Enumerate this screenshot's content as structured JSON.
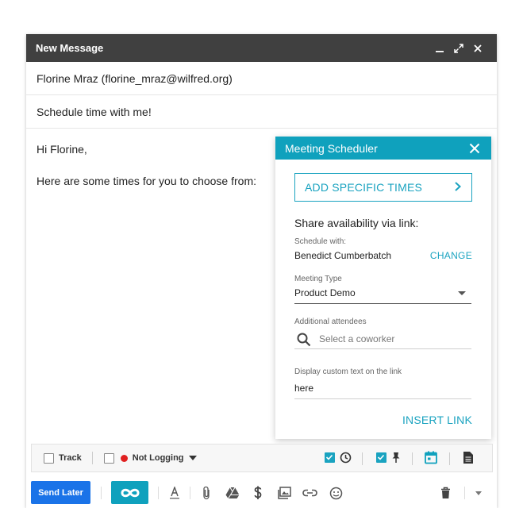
{
  "window": {
    "title": "New Message",
    "to": "Florine Mraz (florine_mraz@wilfred.org)",
    "subject": "Schedule time with me!"
  },
  "body": {
    "greeting": "Hi Florine,",
    "line": "Here are some times for you to choose from:"
  },
  "scheduler": {
    "title": "Meeting Scheduler",
    "add_specific_times": "ADD SPECIFIC TIMES",
    "share_label": "Share availability via link:",
    "schedule_with_label": "Schedule with:",
    "schedule_with_value": "Benedict Cumberbatch",
    "change": "CHANGE",
    "meeting_type_label": "Meeting Type",
    "meeting_type_value": "Product Demo",
    "attendees_label": "Additional attendees",
    "attendees_placeholder": "Select a coworker",
    "custom_text_label": "Display custom text on the link",
    "custom_text_value": "here",
    "insert_link": "INSERT LINK"
  },
  "tracking_bar": {
    "track_label": "Track",
    "logging_label": "Not Logging",
    "logging_color": "#e02020"
  },
  "toolbar": {
    "send_later": "Send Later"
  },
  "colors": {
    "accent": "#0fa1bd",
    "send_button": "#1a73e8",
    "titlebar": "#404040"
  }
}
